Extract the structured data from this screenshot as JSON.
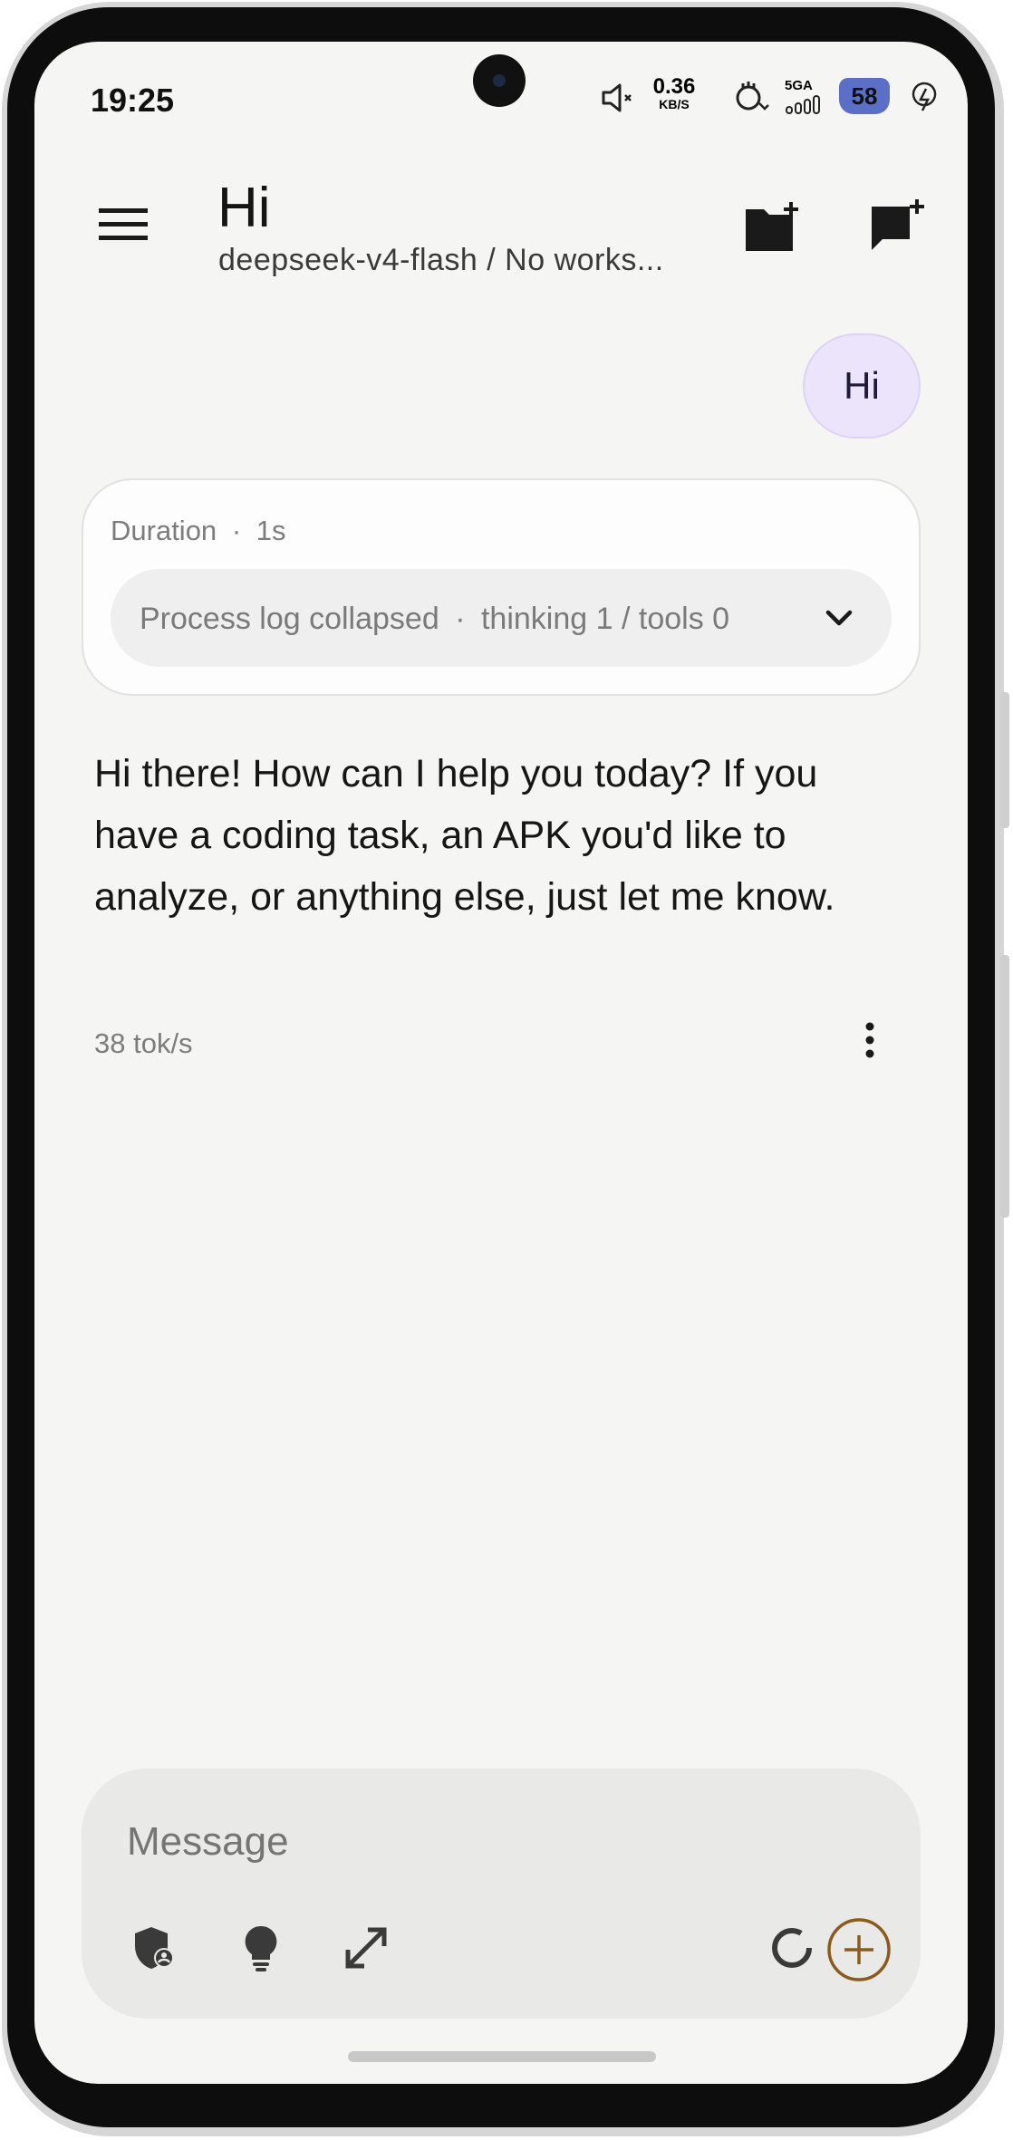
{
  "status_bar": {
    "time": "19:25",
    "net_speed_value": "0.36",
    "net_speed_unit": "KB/S",
    "network": "5GA",
    "battery_level": "58"
  },
  "app_bar": {
    "title": "Hi",
    "subtitle": "deepseek-v4-flash / No works...",
    "menu_icon": "hamburger-menu-icon",
    "new_folder_icon": "create-new-folder-icon",
    "new_chat_icon": "add-comment-icon"
  },
  "conversation": {
    "user_message": "Hi",
    "process_card": {
      "duration_label": "Duration",
      "separator": "·",
      "duration_value": "1s",
      "log_text": "Process log collapsed",
      "log_details": "thinking 1 / tools 0"
    },
    "assistant_message": "Hi there! How can I help you today? If you have a coding task, an APK you'd like to analyze, or anything else, just let me know.",
    "tokens_per_second": "38 tok/s"
  },
  "composer": {
    "placeholder": "Message",
    "tools": [
      "shield-person-icon",
      "lightbulb-icon",
      "expand-icon",
      "loading-ring-icon",
      "add-circle-icon"
    ],
    "accent_color": "#8a5a1e"
  },
  "colors": {
    "background": "#f5f5f4",
    "user_bubble": "#ebe4fb",
    "composer": "#e9e9e8"
  }
}
